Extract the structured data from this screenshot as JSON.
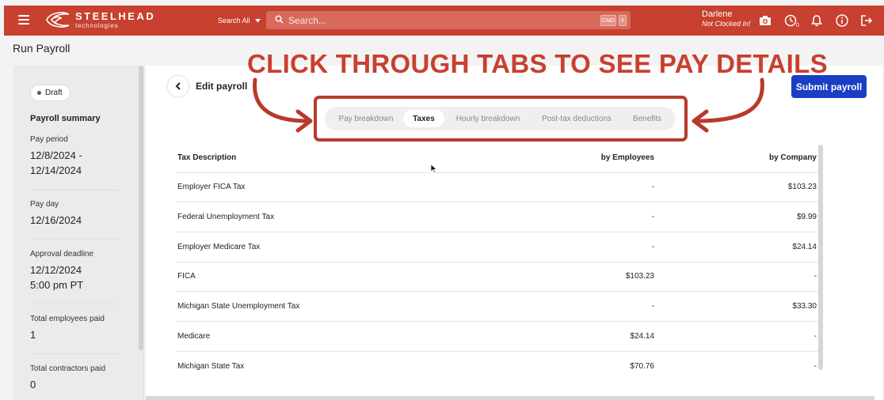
{
  "header": {
    "brand_name": "STEELHEAD",
    "brand_sub": "technologies",
    "search_scope": "Search All",
    "search_placeholder": "Search...",
    "kbd_cmd": "CMD",
    "kbd_x": "X",
    "user_name": "Darlene",
    "user_status": "Not Clocked In!",
    "accent": "#c8402f"
  },
  "page": {
    "title": "Run Payroll"
  },
  "sidebar": {
    "status_badge": "Draft",
    "summary_title": "Payroll summary",
    "pay_period_label": "Pay period",
    "pay_period_start": "12/8/2024 -",
    "pay_period_end": "12/14/2024",
    "pay_day_label": "Pay day",
    "pay_day_value": "12/16/2024",
    "approval_label": "Approval deadline",
    "approval_date": "12/12/2024",
    "approval_time": "5:00 pm PT",
    "employees_label": "Total employees paid",
    "employees_value": "1",
    "contractors_label": "Total contractors paid",
    "contractors_value": "0"
  },
  "main": {
    "edit_title": "Edit payroll",
    "submit_label": "Submit payroll",
    "tabs": [
      "Pay breakdown",
      "Taxes",
      "Hourly breakdown",
      "Post-tax deductions",
      "Benefits"
    ],
    "active_tab": "Taxes",
    "annotation": "CLICK THROUGH TABS TO SEE PAY DETAILS",
    "table": {
      "headers": [
        "Tax Description",
        "by Employees",
        "by Company"
      ],
      "rows": [
        [
          "Employer FICA Tax",
          "-",
          "$103.23"
        ],
        [
          "Federal Unemployment Tax",
          "-",
          "$9.99"
        ],
        [
          "Employer Medicare Tax",
          "-",
          "$24.14"
        ],
        [
          "FICA",
          "$103.23",
          "-"
        ],
        [
          "Michigan State Unemployment Tax",
          "-",
          "$33.30"
        ],
        [
          "Medicare",
          "$24.14",
          "-"
        ],
        [
          "Michigan State Tax",
          "$70.76",
          "-"
        ]
      ]
    }
  }
}
